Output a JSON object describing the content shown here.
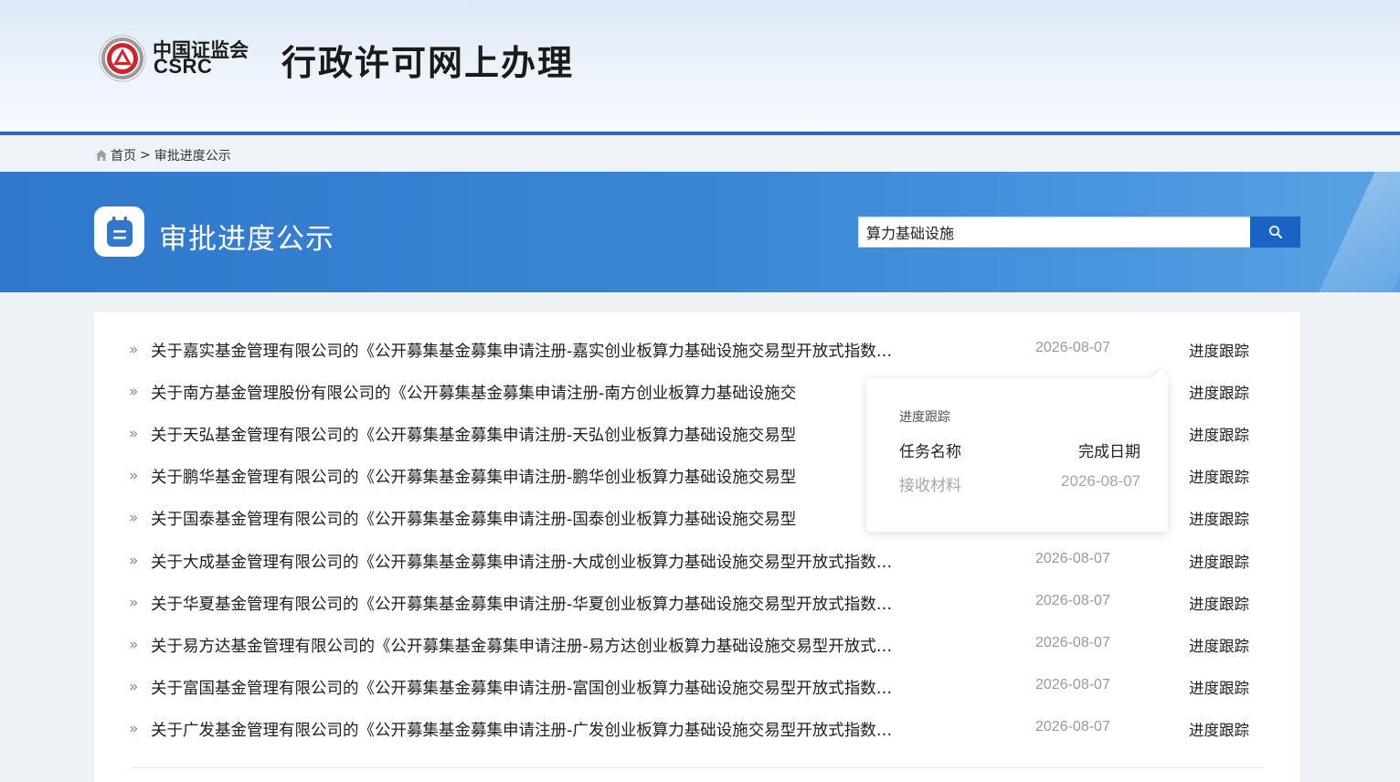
{
  "header": {
    "logo_cn": "中国证监会",
    "logo_en": "CSRC",
    "site_title": "行政许可网上办理",
    "brand_color": "#d2232a",
    "accent_color": "#2a68b8"
  },
  "breadcrumb": {
    "home_label": "首页",
    "separator": ">",
    "current": "审批进度公示"
  },
  "banner": {
    "title": "审批进度公示",
    "icon": "notepad-icon"
  },
  "search": {
    "value": "算力基础设施",
    "icon": "search-icon"
  },
  "list": {
    "rows": [
      {
        "title": "关于嘉实基金管理有限公司的《公开募集基金募集申请注册-嘉实创业板算力基础设施交易型开放式指数…",
        "date": "2026-08-07",
        "action": "进度跟踪"
      },
      {
        "title": "关于南方基金管理股份有限公司的《公开募集基金募集申请注册-南方创业板算力基础设施交",
        "date": "",
        "action": "进度跟踪"
      },
      {
        "title": "关于天弘基金管理有限公司的《公开募集基金募集申请注册-天弘创业板算力基础设施交易型",
        "date": "",
        "action": "进度跟踪"
      },
      {
        "title": "关于鹏华基金管理有限公司的《公开募集基金募集申请注册-鹏华创业板算力基础设施交易型",
        "date": "",
        "action": "进度跟踪"
      },
      {
        "title": "关于国泰基金管理有限公司的《公开募集基金募集申请注册-国泰创业板算力基础设施交易型",
        "date": "",
        "action": "进度跟踪"
      },
      {
        "title": "关于大成基金管理有限公司的《公开募集基金募集申请注册-大成创业板算力基础设施交易型开放式指数…",
        "date": "2026-08-07",
        "action": "进度跟踪"
      },
      {
        "title": "关于华夏基金管理有限公司的《公开募集基金募集申请注册-华夏创业板算力基础设施交易型开放式指数…",
        "date": "2026-08-07",
        "action": "进度跟踪"
      },
      {
        "title": "关于易方达基金管理有限公司的《公开募集基金募集申请注册-易方达创业板算力基础设施交易型开放式…",
        "date": "2026-08-07",
        "action": "进度跟踪"
      },
      {
        "title": "关于富国基金管理有限公司的《公开募集基金募集申请注册-富国创业板算力基础设施交易型开放式指数…",
        "date": "2026-08-07",
        "action": "进度跟踪"
      },
      {
        "title": "关于广发基金管理有限公司的《公开募集基金募集申请注册-广发创业板算力基础设施交易型开放式指数…",
        "date": "2026-08-07",
        "action": "进度跟踪"
      }
    ]
  },
  "popup": {
    "title": "进度跟踪",
    "col_name": "任务名称",
    "col_date": "完成日期",
    "task_name": "接收材料",
    "task_date": "2026-08-07"
  }
}
